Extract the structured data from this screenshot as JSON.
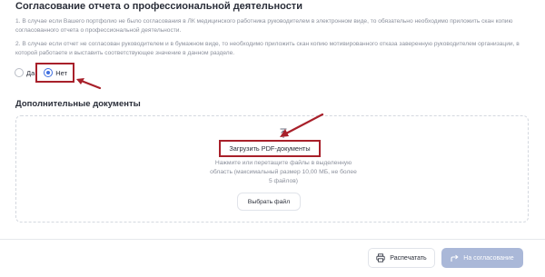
{
  "section": {
    "title": "Согласование отчета о профессиональной деятельности",
    "notes": [
      "1. В случае если Вашего портфолио не было согласования в ЛК медицинского работника руководителем в электронном виде, то обязательно необходимо приложить скан копию согласованного отчета о профессиональной деятельности.",
      "2. В случае если отчет не согласован руководителем и в бумажном виде, то необходимо приложить скан копию мотивированного отказа заверенную руководителем организации, в которой работаете и выставить соответствующее значение в данном разделе."
    ]
  },
  "radio": {
    "options": [
      {
        "label": "Да",
        "checked": false
      },
      {
        "label": "Нет",
        "checked": true
      }
    ]
  },
  "documents": {
    "title": "Дополнительные документы",
    "upload_label": "Загрузить PDF-документы",
    "hint": "Нажмите или перетащите файлы в выделенную область (максимальный размер 10,00 МБ, не более 5 файлов)",
    "choose_file": "Выбрать файл"
  },
  "footer": {
    "print_label": "Распечатать",
    "approve_label": "На согласование"
  },
  "colors": {
    "accent": "#3f6fe0",
    "highlight": "#a8202a",
    "approve_bg": "#aab8d8"
  },
  "icons": [
    "upload-icon",
    "printer-icon",
    "forward-arrow-icon"
  ]
}
